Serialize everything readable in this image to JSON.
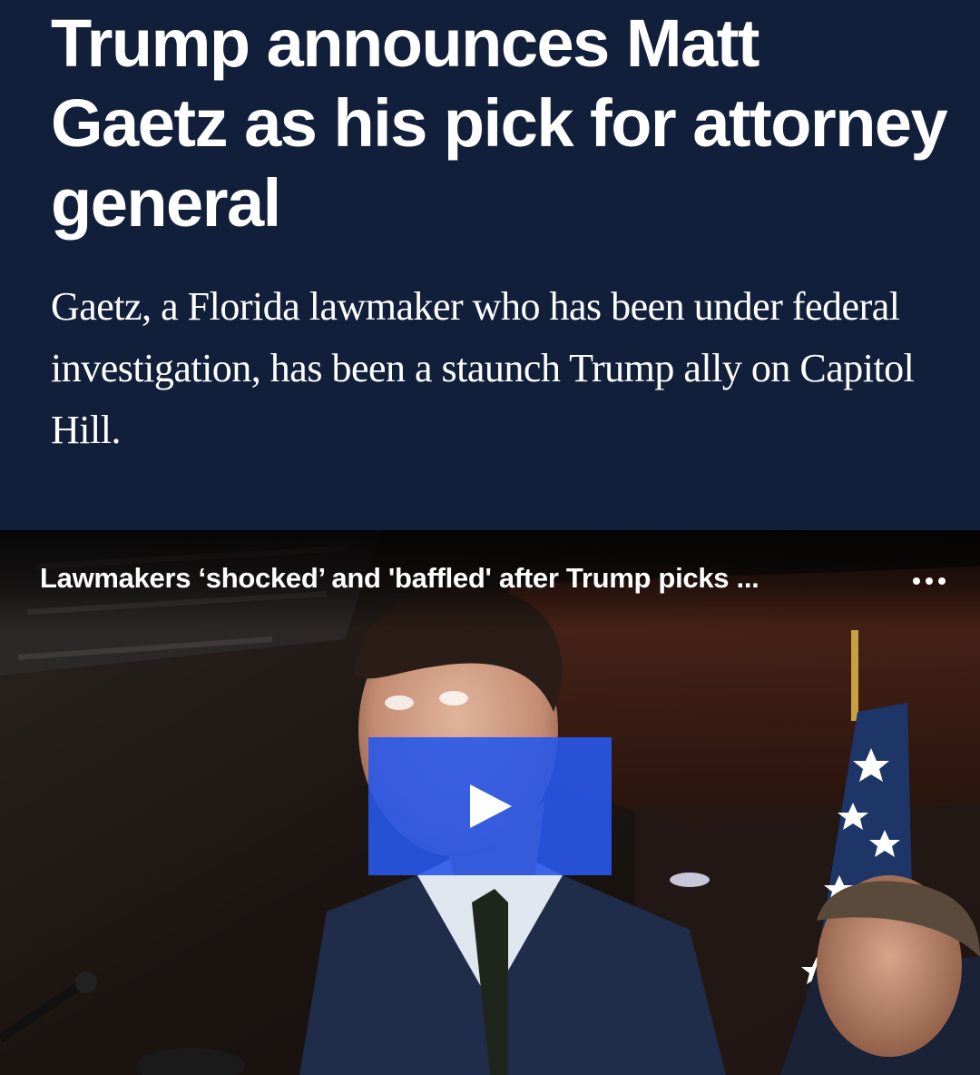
{
  "article": {
    "headline": "Trump announces Matt Gaetz as his pick for attorney general",
    "dek": "Gaetz, a Florida lawmaker who has been under federal investigation, has been a staunch Trump ally on Capitol Hill."
  },
  "video": {
    "title": "Lawmakers ‘shocked’ and 'baffled' after Trump picks ...",
    "more_icon": "more-horizontal-icon",
    "play_icon": "play-icon",
    "play_button_color": "#2858eb"
  },
  "colors": {
    "header_background": "#121f3b",
    "text": "#ffffff"
  }
}
